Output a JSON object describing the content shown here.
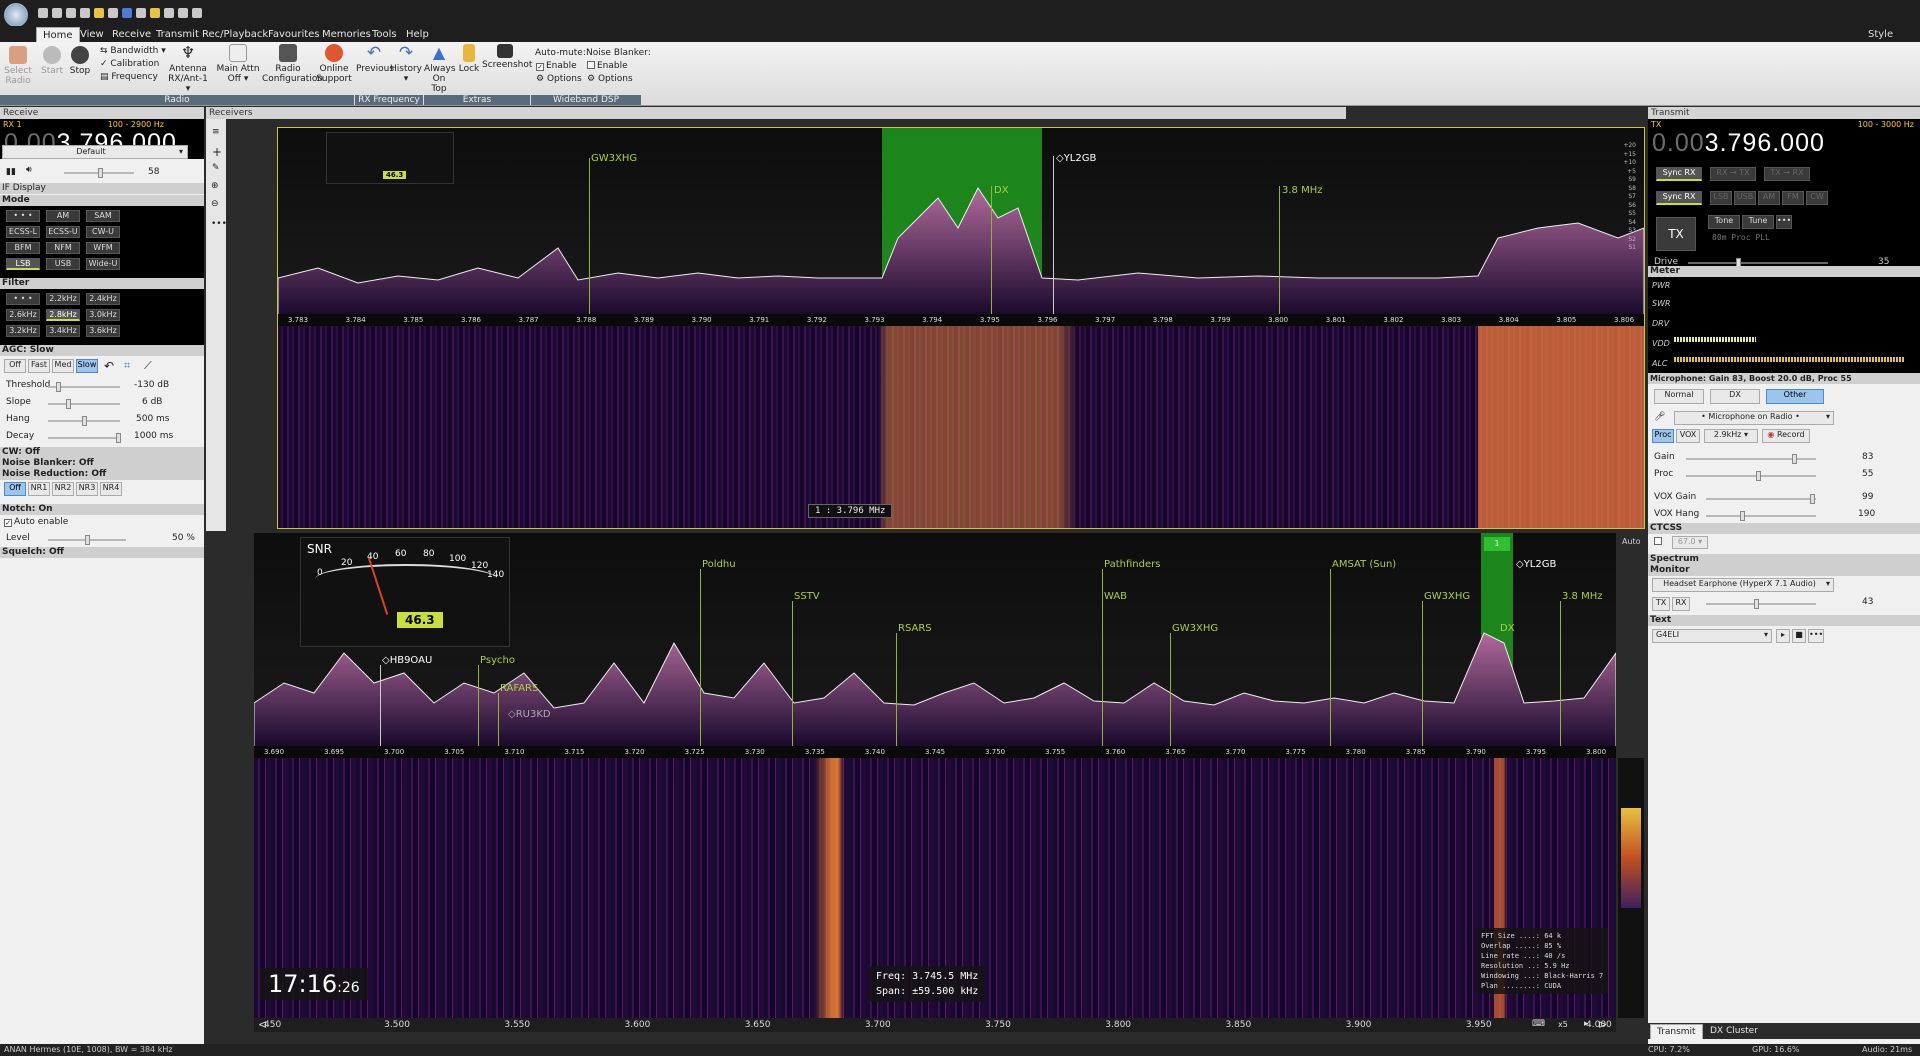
{
  "toolbar": {
    "tabs": [
      "Home",
      "View",
      "Receive",
      "Transmit",
      "Rec/Playback",
      "Favourites",
      "Memories",
      "Tools",
      "Help"
    ],
    "style_label": "Style"
  },
  "ribbon": {
    "select_radio": "Select Radio",
    "start": "Start",
    "stop": "Stop",
    "bandwidth": "Bandwidth",
    "calibration": "Calibration",
    "frequency": "Frequency",
    "antenna": "Antenna",
    "antenna_sub": "RX/Ant-1",
    "main_attn": "Main Attn",
    "main_attn_sub": "Off",
    "radio_config": "Radio Configuration",
    "online_support": "Online Support",
    "previous": "Previous",
    "history": "History",
    "always_on_top": "Always On Top",
    "lock": "Lock",
    "screenshot": "Screenshot",
    "auto_mute": "Auto-mute:",
    "noise_blanker": "Noise Blanker:",
    "enable": "Enable",
    "options": "Options",
    "groups": {
      "radio": "Radio",
      "rx_frequency": "RX Frequency",
      "extras": "Extras",
      "wideband_dsp": "Wideband DSP"
    }
  },
  "receive": {
    "title": "Receive",
    "rx_label": "RX 1",
    "bw_range": "100 - 2900 Hz",
    "freq_dim": "0.00",
    "freq": "3.796.000",
    "profile": "Default",
    "volume": "58",
    "if_display": "IF Display",
    "mode_label": "Mode",
    "modes": [
      "• • •",
      "AM",
      "SAM",
      "ECSS-L",
      "ECSS-U",
      "CW-U",
      "BFM",
      "NFM",
      "WFM",
      "LSB",
      "USB",
      "Wide-U"
    ],
    "filter_label": "Filter",
    "filters": [
      "• • •",
      "2.2kHz",
      "2.4kHz",
      "2.6kHz",
      "2.8kHz",
      "3.0kHz",
      "3.2kHz",
      "3.4kHz",
      "3.6kHz"
    ],
    "agc_label": "AGC: Slow",
    "agc": [
      "Off",
      "Fast",
      "Med",
      "Slow"
    ],
    "threshold": {
      "label": "Threshold",
      "value": "-130 dB"
    },
    "slope": {
      "label": "Slope",
      "value": "6 dB"
    },
    "hang": {
      "label": "Hang",
      "value": "500 ms"
    },
    "decay": {
      "label": "Decay",
      "value": "1000 ms"
    },
    "cw": "CW: Off",
    "noise_blanker": "Noise Blanker: Off",
    "noise_reduction": "Noise Reduction: Off",
    "nr": [
      "Off",
      "NR1",
      "NR2",
      "NR3",
      "NR4"
    ],
    "notch": "Notch: On",
    "auto_enable": "Auto enable",
    "level": {
      "label": "Level",
      "value": "50 %"
    },
    "squelch": "Squelch: Off"
  },
  "receivers": {
    "title": "Receivers",
    "top": {
      "smeter_value": "46.3",
      "labels": [
        "GW3XHG",
        "DX",
        "◇YL2GB",
        "3.8 MHz"
      ],
      "axis": [
        "3.783",
        "3.784",
        "3.785",
        "3.786",
        "3.787",
        "3.788",
        "3.789",
        "3.790",
        "3.791",
        "3.792",
        "3.793",
        "3.794",
        "3.795",
        "3.796",
        "3.797",
        "3.798",
        "3.799",
        "3.800",
        "3.801",
        "3.802",
        "3.803",
        "3.804",
        "3.805",
        "3.806"
      ],
      "cursor": "1 : 3.796 MHz",
      "scale": [
        "+20",
        "+15",
        "+10",
        "+5",
        "S9",
        "S8",
        "S7",
        "S6",
        "S5",
        "S4",
        "S3",
        "S2",
        "S1"
      ]
    },
    "bottom": {
      "snr_title": "SNR",
      "snr_ticks": [
        "0",
        "20",
        "40",
        "60",
        "80",
        "100",
        "120",
        "140"
      ],
      "snr_value": "46.3",
      "labels": [
        "Poldhu",
        "SSTV",
        "RSARS",
        "Pathfinders",
        "WAB",
        "GW3XHG",
        "AMSAT (Sun)",
        "GW3XHG",
        "3.8 MHz",
        "◇YL2GB",
        "DX",
        "◇HB9OAU",
        "Psycho",
        "RAFARS",
        "◇RU3KD"
      ],
      "rx_badge": "1",
      "auto": "Auto",
      "axis": [
        "3.690",
        "3.695",
        "3.700",
        "3.705",
        "3.710",
        "3.715",
        "3.720",
        "3.725",
        "3.730",
        "3.735",
        "3.740",
        "3.745",
        "3.750",
        "3.755",
        "3.760",
        "3.765",
        "3.770",
        "3.775",
        "3.780",
        "3.785",
        "3.790",
        "3.795",
        "3.800"
      ],
      "time": "17:16",
      "time_sec": ":26",
      "freq_readout": "Freq: 3.745.5 MHz",
      "span_readout": "Span: ±59.500 kHz",
      "fft": [
        "FFT Size ....: 64 k",
        "Overlap .....: 85 %",
        "Line rate ...: 40 /s",
        "Resolution ..: 5.9 Hz",
        "Windowing ...: Black-Harris 7",
        "Plan ........: CUDA"
      ],
      "wide_axis": [
        "450",
        "3.500",
        "3.550",
        "3.600",
        "3.650",
        "3.700",
        "3.750",
        "3.800",
        "3.850",
        "3.900",
        "3.950",
        "4.000"
      ],
      "zoom": "x5"
    }
  },
  "transmit": {
    "title": "Transmit",
    "tx_label": "TX",
    "bw_range": "100 - 3000 Hz",
    "freq_dim": "0.00",
    "freq": "3.796.000",
    "sync_rx": "Sync RX",
    "tx_btn": "TX",
    "tone": "Tone",
    "tune": "Tune",
    "proc_pll": "80m Proc PLL",
    "drive": {
      "label": "Drive",
      "value": "35"
    },
    "meter_label": "Meter",
    "meters": [
      "PWR",
      "SWR",
      "DRV",
      "VDD",
      "ALC"
    ],
    "mic_label": "Microphone: Gain 83, Boost 20.0 dB, Proc 55",
    "presets": [
      "Normal",
      "DX",
      "Other"
    ],
    "mic_source": "• Microphone on Radio •",
    "proc": "Proc",
    "vox": "VOX",
    "bw": "2.9kHz",
    "record": "Record",
    "gain": {
      "label": "Gain",
      "value": "83"
    },
    "proc_lvl": {
      "label": "Proc",
      "value": "55"
    },
    "vox_gain": {
      "label": "VOX Gain",
      "value": "99"
    },
    "vox_hang": {
      "label": "VOX Hang",
      "value": "190"
    },
    "ctcss": "CTCSS",
    "ctcss_val": "67.0",
    "spectrum": "Spectrum",
    "monitor": "Monitor",
    "monitor_dev": "Headset Earphone (HyperX 7.1 Audio)",
    "tx": "TX",
    "rx": "RX",
    "monitor_vol": "43",
    "text": "Text",
    "callsign": "G4ELI",
    "bottom_tabs": [
      "Transmit",
      "DX Cluster"
    ]
  },
  "status": {
    "left": "ANAN Hermes (10E, 1008), BW = 384 kHz",
    "cpu": "CPU: 7.2%",
    "gpu": "GPU: 16.6%",
    "audio": "Audio: 21ms"
  }
}
